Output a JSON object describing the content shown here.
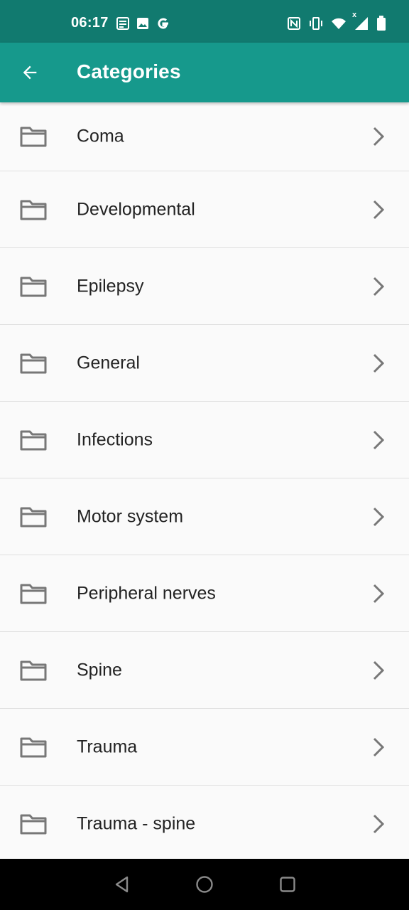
{
  "status_bar": {
    "time": "06:17",
    "left_icons": [
      "news-icon",
      "image-icon",
      "google-icon"
    ],
    "right_icons": [
      "nfc-icon",
      "vibrate-icon",
      "wifi-icon",
      "signal-icon",
      "battery-icon"
    ],
    "signal_badge": "x"
  },
  "app_bar": {
    "title": "Categories",
    "back_icon": "arrow-back-icon",
    "color": "#16998c",
    "status_color": "#117a6f"
  },
  "categories": [
    {
      "label": "Coma"
    },
    {
      "label": "Developmental"
    },
    {
      "label": "Epilepsy"
    },
    {
      "label": "General"
    },
    {
      "label": "Infections"
    },
    {
      "label": "Motor system"
    },
    {
      "label": "Peripheral nerves"
    },
    {
      "label": "Spine"
    },
    {
      "label": "Trauma"
    },
    {
      "label": "Trauma - spine"
    }
  ],
  "nav_bar": {
    "buttons": [
      "back-triangle-icon",
      "home-circle-icon",
      "recents-square-icon"
    ]
  }
}
